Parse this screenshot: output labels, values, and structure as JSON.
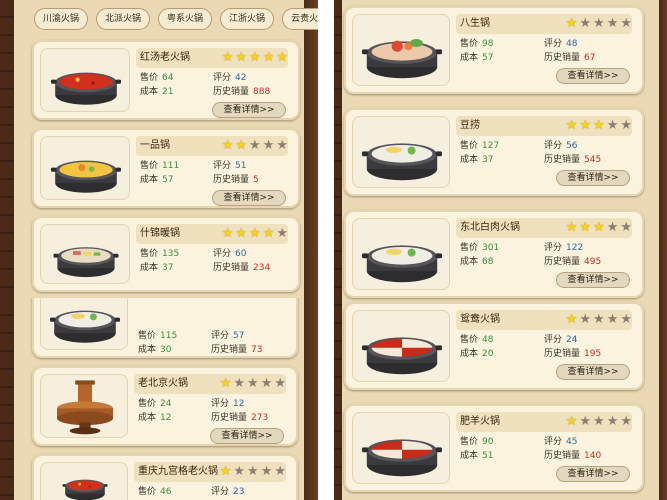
{
  "tabs": [
    "川渝火锅",
    "北派火锅",
    "粤系火锅",
    "江浙火锅",
    "云贵火锅"
  ],
  "labels": {
    "price": "售价",
    "cost": "成本",
    "score": "评分",
    "history_sales": "历史销量",
    "details_button": "查看详情>>"
  },
  "colors": {
    "card_bg": "#fbf3dd",
    "name_bar": "#efe1bd",
    "star_on": "#f6d21c",
    "star_off": "#8a7e70",
    "value_green": "#37943b",
    "value_blue": "#2b6cb0",
    "value_red": "#c42e24",
    "wood": "#4a2a17"
  },
  "top_left_items": [
    {
      "name": "红汤老火锅",
      "stars": 5,
      "price": "64",
      "cost": "21",
      "score": "42",
      "sales": "888",
      "icon": "red-hotpot-icon"
    },
    {
      "name": "一品锅",
      "stars": 2,
      "price": "111",
      "cost": "57",
      "score": "51",
      "sales": "5",
      "icon": "yipin-pot-icon"
    },
    {
      "name": "什锦暖锅",
      "stars": 4,
      "price": "135",
      "cost": "37",
      "score": "60",
      "sales": "234",
      "icon": "assorted-pot-icon"
    }
  ],
  "bottom_left_items": [
    {
      "name": "",
      "stars": 0,
      "price": "115",
      "cost": "30",
      "score": "57",
      "sales": "73",
      "icon": "dumpling-pot-icon"
    },
    {
      "name": "老北京火锅",
      "stars": 1,
      "price": "24",
      "cost": "12",
      "score": "12",
      "sales": "273",
      "icon": "copper-pot-icon"
    },
    {
      "name": "重庆九宫格老火锅",
      "stars": 1,
      "price": "46",
      "cost": "",
      "score": "23",
      "sales": "",
      "icon": "grid-hotpot-icon"
    }
  ],
  "right_items": [
    {
      "name": "八生锅",
      "stars": 1,
      "price": "98",
      "cost": "57",
      "score": "48",
      "sales": "67",
      "icon": "seafood-pot-icon"
    },
    {
      "name": "豆捞",
      "stars": 3,
      "price": "127",
      "cost": "37",
      "score": "56",
      "sales": "545",
      "icon": "doulao-pot-icon"
    },
    {
      "name": "东北白肉火锅",
      "stars": 3,
      "price": "301",
      "cost": "68",
      "score": "122",
      "sales": "495",
      "icon": "white-pork-pot-icon"
    },
    {
      "name": "鸳鸯火锅",
      "stars": 1,
      "price": "48",
      "cost": "20",
      "score": "24",
      "sales": "195",
      "icon": "yuanyang-pot-icon"
    },
    {
      "name": "肥羊火锅",
      "stars": 1,
      "price": "90",
      "cost": "51",
      "score": "45",
      "sales": "140",
      "icon": "lamb-pot-icon"
    }
  ]
}
